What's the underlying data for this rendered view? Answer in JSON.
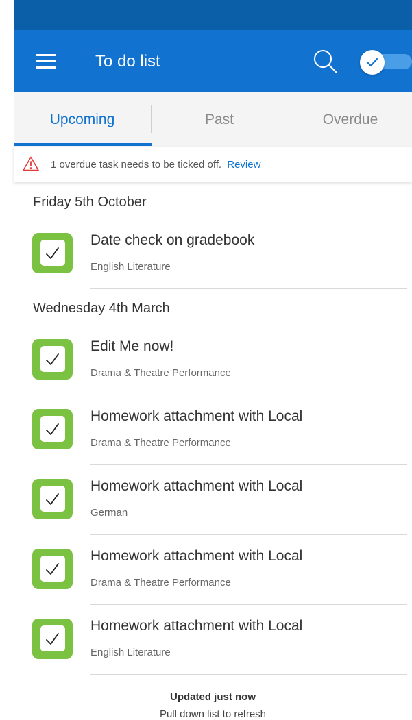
{
  "app": {
    "title": "To do list",
    "icons": {
      "menu": "hamburger-menu-icon",
      "search": "search-icon",
      "toggle": "checkmark-toggle"
    },
    "colors": {
      "header": "#1172cf",
      "status_bar": "#0a5fa8",
      "checkbox": "#7cc242",
      "warning": "#e53935"
    }
  },
  "tabs": [
    {
      "label": "Upcoming",
      "active": true
    },
    {
      "label": "Past",
      "active": false
    },
    {
      "label": "Overdue",
      "active": false
    }
  ],
  "warning": {
    "message": "1 overdue task needs to be ticked off.",
    "link": "Review",
    "icon": "warning-triangle-icon"
  },
  "sections": [
    {
      "date": "Friday 5th October",
      "tasks": [
        {
          "title": "Date check on gradebook",
          "subject": "English Literature",
          "checked": true
        }
      ]
    },
    {
      "date": "Wednesday 4th March",
      "tasks": [
        {
          "title": "Edit Me now!",
          "subject": "Drama & Theatre Performance",
          "checked": true
        },
        {
          "title": "Homework attachment with Local",
          "subject": "Drama & Theatre Performance",
          "checked": true
        },
        {
          "title": "Homework attachment with Local",
          "subject": "German",
          "checked": true
        },
        {
          "title": "Homework attachment with Local",
          "subject": "Drama & Theatre Performance",
          "checked": true
        },
        {
          "title": "Homework attachment with Local",
          "subject": "English Literature",
          "checked": true
        }
      ]
    }
  ],
  "footer": {
    "status": "Updated just now",
    "hint": "Pull down list to refresh"
  }
}
